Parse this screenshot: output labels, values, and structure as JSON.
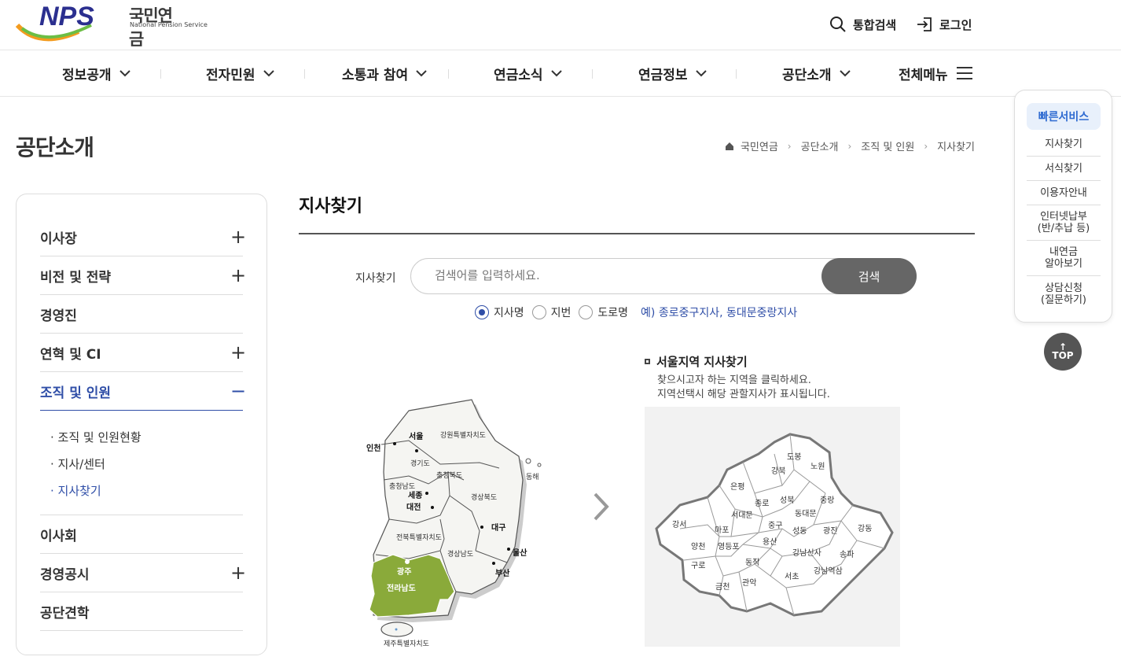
{
  "brand": {
    "logo_text": "NPS",
    "name_ko": "국민연금",
    "name_en": "National Pension Service"
  },
  "util": {
    "search_label": "통합검색",
    "login_label": "로그인"
  },
  "gnb": [
    {
      "label": "정보공개"
    },
    {
      "label": "전자민원"
    },
    {
      "label": "소통과 참여"
    },
    {
      "label": "연금소식"
    },
    {
      "label": "연금정보"
    },
    {
      "label": "공단소개"
    }
  ],
  "gnb_all": "전체메뉴",
  "page": {
    "title": "공단소개"
  },
  "breadcrumb": [
    "국민연금",
    "공단소개",
    "조직 및 인원",
    "지사찾기"
  ],
  "lnb": [
    {
      "label": "이사장",
      "toggle": "+"
    },
    {
      "label": "비전 및 전략",
      "toggle": "+"
    },
    {
      "label": "경영진",
      "toggle": ""
    },
    {
      "label": "연혁 및 CI",
      "toggle": "+"
    },
    {
      "label": "조직 및 인원",
      "toggle": "−"
    },
    {
      "label": "이사회",
      "toggle": ""
    },
    {
      "label": "경영공시",
      "toggle": "+"
    },
    {
      "label": "공단견학",
      "toggle": ""
    }
  ],
  "lnb_sub": [
    {
      "label": "· 조직 및 인원현황"
    },
    {
      "label": "· 지사/센터"
    },
    {
      "label": "· 지사찾기"
    }
  ],
  "content": {
    "title": "지사찾기",
    "search_label": "지사찾기",
    "search_placeholder": "검색어를 입력하세요.",
    "search_button": "검색",
    "radios": [
      {
        "label": "지사명",
        "checked": true
      },
      {
        "label": "지번",
        "checked": false
      },
      {
        "label": "도로명",
        "checked": false
      }
    ],
    "example": "예) 종로중구지사, 동대문중랑지사"
  },
  "korea_map": {
    "labels": {
      "seoul": "서울",
      "incheon": "인천",
      "gangwon": "강원특별자치도",
      "gyeonggi": "경기도",
      "chungbuk": "충청북도",
      "chungnam": "충청남도",
      "sejong": "세종",
      "daejeon": "대전",
      "gyeongbuk": "경상북도",
      "daegu": "대구",
      "jeonbuk": "전북특별자치도",
      "gyeongnam": "경상남도",
      "ulsan": "울산",
      "busan": "부산",
      "gwangju": "광주",
      "jeonnam": "전라남도",
      "jeju": "제주특별자치도",
      "donghae": "동해"
    },
    "highlight_color": "#8aaa3a"
  },
  "seoul": {
    "title": "서울지역 지사찾기",
    "desc1": "찾으시고자 하는 지역을 클릭하세요.",
    "desc2": "지역선택시 해당 관할지사가 표시됩니다.",
    "districts": {
      "dobong": "도봉",
      "nowon": "노원",
      "gangbuk": "강북",
      "eunpyeong": "은평",
      "seongbuk": "성북",
      "jongno": "종로",
      "jungnang": "중랑",
      "seodaemun": "서대문",
      "dongdaemun": "동대문",
      "gangseo": "강서",
      "mapo": "마포",
      "jung": "중구",
      "seongdong": "성동",
      "gwangjin": "광진",
      "gangdong": "강동",
      "yangcheon": "양천",
      "yeongdeungpo": "영등포",
      "yongsan": "용산",
      "guro": "구로",
      "dongjak": "동작",
      "gangnamsinsa": "강남신사",
      "songpa": "송파",
      "gangnamyeoksam": "강남역삼",
      "geumcheon": "금천",
      "gwanak": "관악",
      "seocho": "서초"
    }
  },
  "quick": {
    "title": "빠른서비스",
    "items": [
      {
        "line1": "지사찾기",
        "line2": ""
      },
      {
        "line1": "서식찾기",
        "line2": ""
      },
      {
        "line1": "이용자안내",
        "line2": ""
      },
      {
        "line1": "인터넷납부",
        "line2": "(반/추납 등)"
      },
      {
        "line1": "내연금",
        "line2": "알아보기"
      },
      {
        "line1": "상담신청",
        "line2": "(질문하기)"
      }
    ],
    "top_label": "TOP"
  },
  "colors": {
    "accent": "#2f4ea7",
    "button": "#666666",
    "map_highlight": "#8aaa3a",
    "map_fill": "#f5f5f2"
  }
}
